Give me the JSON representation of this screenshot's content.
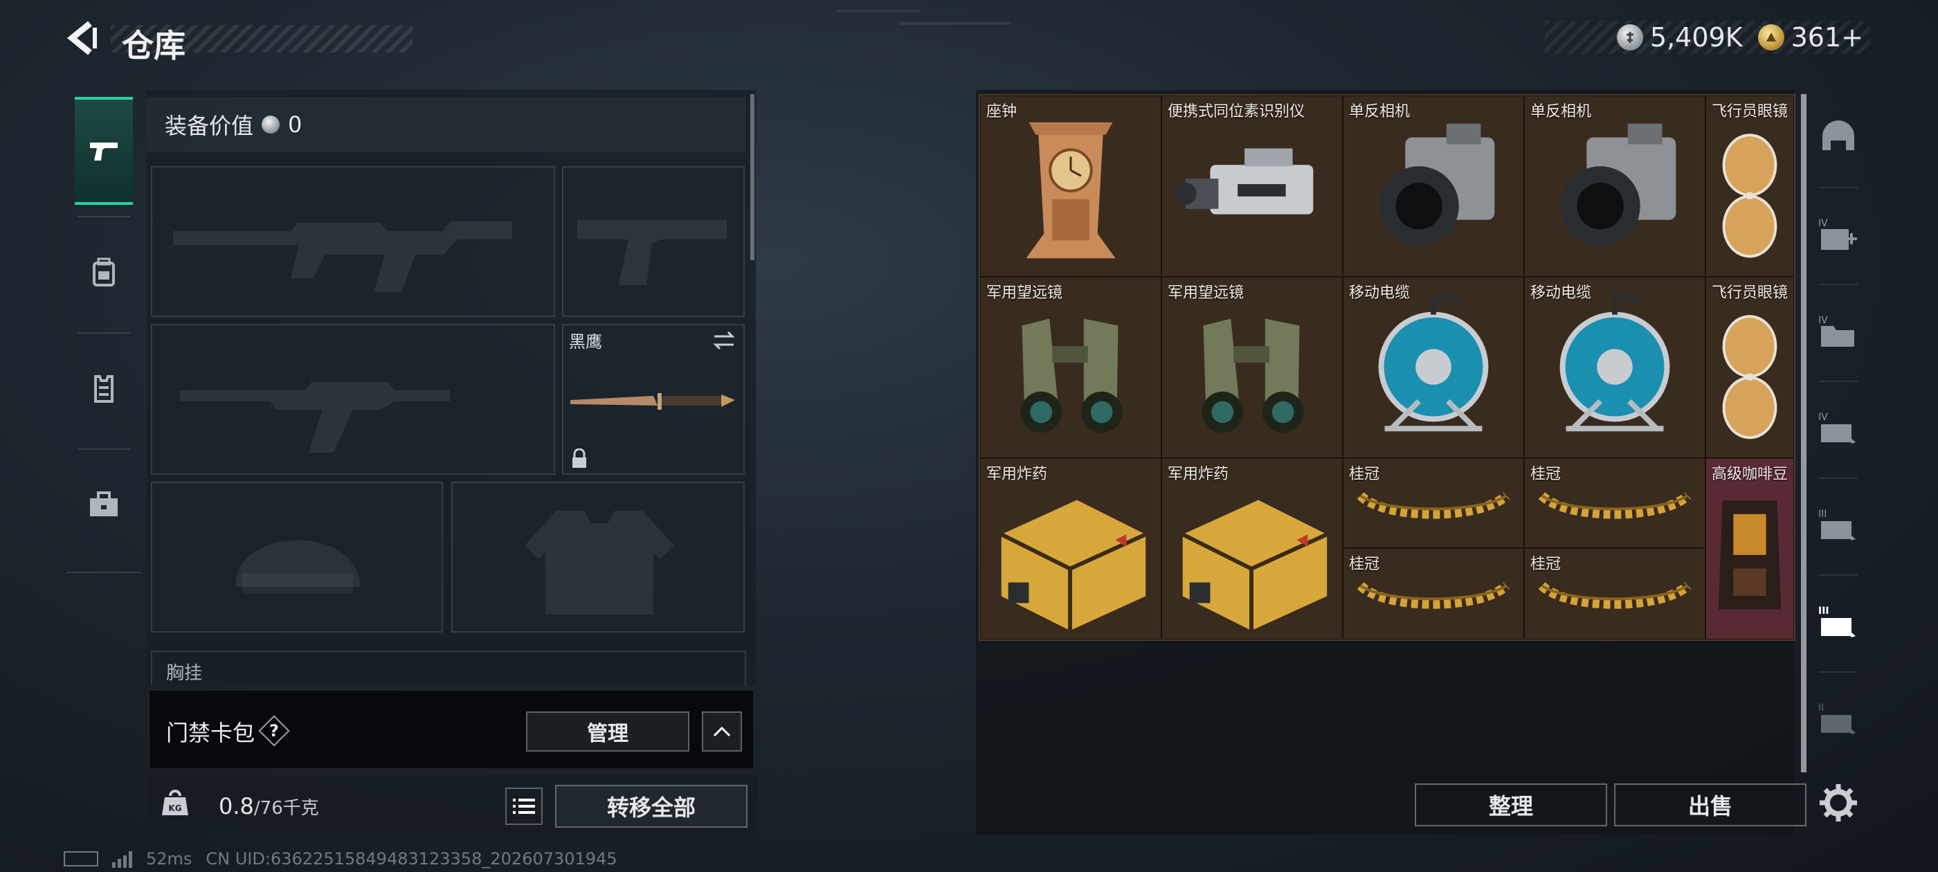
{
  "header": {
    "title": "仓库",
    "currency": [
      {
        "icon": "silver-coin-icon",
        "value": "5,409K"
      },
      {
        "icon": "gold-coin-icon",
        "value": "361+"
      }
    ]
  },
  "left_tabs": [
    {
      "icon": "pistol-icon",
      "active": true
    },
    {
      "icon": "backpack-icon",
      "active": false
    },
    {
      "icon": "vest-icon",
      "active": false
    },
    {
      "icon": "toolbox-icon",
      "active": false
    }
  ],
  "loadout": {
    "equip_value_label": "装备价值",
    "equip_value": "0",
    "melee_name": "黑鹰",
    "chest_rig_label": "胸挂"
  },
  "keycard": {
    "label": "门禁卡包",
    "help": "?",
    "manage_label": "管理"
  },
  "weight": {
    "current": "0.8",
    "max": "/76千克",
    "kg_icon_text": "KG",
    "transfer_all_label": "转移全部"
  },
  "status": {
    "ping": "52ms",
    "uid": "CN UID:636225158494831233​58_202607301945"
  },
  "warehouse": {
    "items": [
      {
        "name": "座钟",
        "icon": "mantel-clock-icon"
      },
      {
        "name": "便携式同位素识别仪",
        "icon": "isotope-scanner-icon"
      },
      {
        "name": "单反相机",
        "icon": "dslr-camera-icon"
      },
      {
        "name": "单反相机",
        "icon": "dslr-camera-icon"
      },
      {
        "name": "飞行员眼镜",
        "icon": "aviator-glasses-icon"
      },
      {
        "name": "军用望远镜",
        "icon": "binoculars-icon"
      },
      {
        "name": "军用望远镜",
        "icon": "binoculars-icon"
      },
      {
        "name": "移动电缆",
        "icon": "cable-reel-icon"
      },
      {
        "name": "移动电缆",
        "icon": "cable-reel-icon"
      },
      {
        "name": "飞行员眼镜",
        "icon": "aviator-glasses-icon"
      },
      {
        "name": "军用炸药",
        "icon": "explosive-crate-icon"
      },
      {
        "name": "军用炸药",
        "icon": "explosive-crate-icon"
      },
      {
        "name": "桂冠",
        "icon": "laurel-wreath-icon"
      },
      {
        "name": "桂冠",
        "icon": "laurel-wreath-icon"
      },
      {
        "name": "高级咖啡豆",
        "icon": "coffee-bag-icon"
      },
      {
        "name": "桂冠",
        "icon": "laurel-wreath-icon"
      },
      {
        "name": "桂冠",
        "icon": "laurel-wreath-icon"
      }
    ],
    "sort_label": "整理",
    "sell_label": "出售"
  },
  "right_tabs": [
    {
      "icon": "helmet-tab-icon"
    },
    {
      "icon": "medkit-tier4-icon",
      "tier": "IV"
    },
    {
      "icon": "folder-tier4-icon",
      "tier": "IV"
    },
    {
      "icon": "case-tier4-icon",
      "tier": "IV"
    },
    {
      "icon": "case-tier3-icon",
      "tier": "III"
    },
    {
      "icon": "case-tier3-active-icon",
      "tier": "III"
    },
    {
      "icon": "case-tier2-icon",
      "tier": "II"
    },
    {
      "icon": "settings-gear-icon"
    }
  ],
  "colors": {
    "accent": "#26d3a8",
    "grid_bg": "#3a2b1f",
    "rare_bg": "#5a2a34"
  }
}
